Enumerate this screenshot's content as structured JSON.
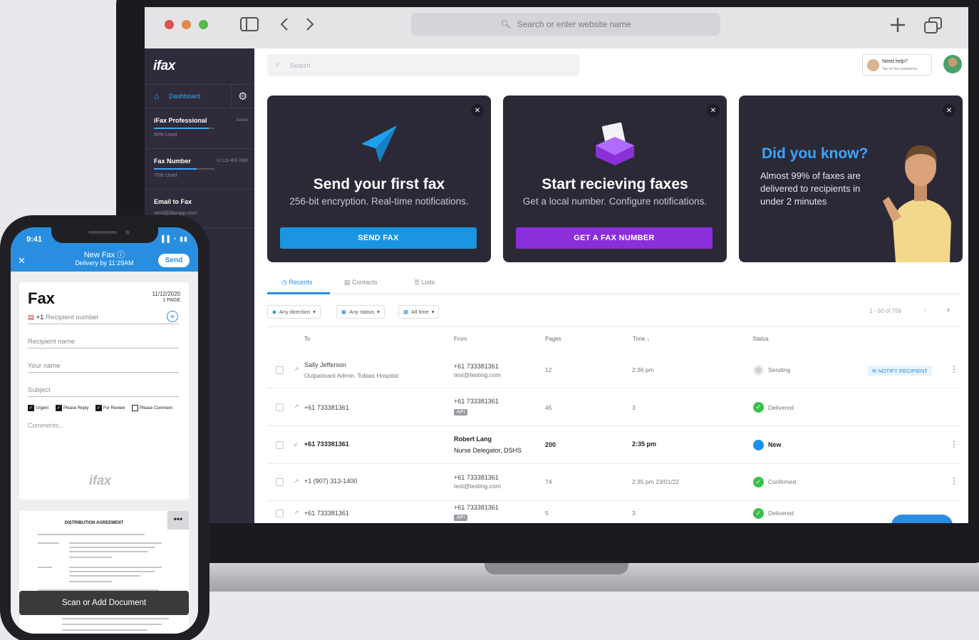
{
  "browser": {
    "address_placeholder": "Search or enter website name"
  },
  "sidebar": {
    "logo": "ifax",
    "nav_dashboard": "Dashboard",
    "plan": {
      "title": "iFax Professional",
      "status": "Active",
      "usage": "90% Used",
      "usage_fraction": 0.9
    },
    "fax_number": {
      "title": "Fax Number",
      "number": "+1 123 456 7890",
      "usage": "70% Used",
      "usage_fraction": 0.7
    },
    "email_to_fax": {
      "title": "Email to Fax",
      "email": "send@ifaxapp.com"
    }
  },
  "header": {
    "search_placeholder": "Search",
    "help_title": "Need help?",
    "help_sub": "Tap for live assistance."
  },
  "cards": [
    {
      "title": "Send your first fax",
      "subtitle": "256-bit encryption. Real-time notifications.",
      "button": "SEND FAX",
      "color": "#1a95e0"
    },
    {
      "title": "Start recieving faxes",
      "subtitle": "Get a local number. Configure notifications.",
      "button": "GET A FAX NUMBER",
      "color": "#8b2fd8"
    },
    {
      "title": "Did you know?",
      "text": "Almost 99% of faxes are delivered to recipients in under 2 minutes"
    }
  ],
  "tabs": {
    "recents": "Recents",
    "contacts": "Contacts",
    "lists": "Lists"
  },
  "filters": {
    "direction": "Any direction",
    "status": "Any status",
    "time": "All time",
    "pagination": "1 - 50 of 756"
  },
  "table": {
    "headers": {
      "to": "To",
      "from": "From",
      "pages": "Pages",
      "time": "Time",
      "status": "Status"
    },
    "rows": [
      {
        "to": "Sally Jefferson",
        "to_sub": "Outpatioant Admin, Tobias Hospital",
        "from": "+61 733381361",
        "from_sub": "test@testing.com",
        "pages": "12",
        "time": "2:36 pm",
        "status": "Sending",
        "action": "NOTIFY RECIPIENT"
      },
      {
        "to": "+61 733381361",
        "from": "+61 733381361",
        "from_tag": "API",
        "pages": "45",
        "time": "3",
        "status": "Delivered"
      },
      {
        "to": "+61 733381361",
        "from": "Robert Lang",
        "from_sub": "Nurse Delegator, DSHS",
        "pages": "200",
        "time": "2:35 pm",
        "status": "New"
      },
      {
        "to": "+1 (907) 313-1400",
        "from": "+61 733381361",
        "from_sub": "test@testing.com",
        "pages": "74",
        "time": "2:35 pm  23/01/22",
        "status": "Confirmed"
      },
      {
        "to": "+61 733381361",
        "from": "+61 733381361",
        "from_tag": "API",
        "pages": "5",
        "time": "3",
        "status": "Delivered"
      }
    ]
  },
  "phone": {
    "time": "9:41",
    "title": "New Fax",
    "subtitle": "Delivery by 11:29AM",
    "send": "Send",
    "fax_heading": "Fax",
    "date": "11/12/2020",
    "pages": "1 PAGE",
    "country_code": "+1",
    "recipient_number": "Recipient number",
    "recipient_name": "Recipient name",
    "your_name": "Your name",
    "subject": "Subject",
    "checks": [
      {
        "label": "Urgent",
        "checked": true
      },
      {
        "label": "Please Reply",
        "checked": true
      },
      {
        "label": "For Review",
        "checked": true
      },
      {
        "label": "Please Comment",
        "checked": false
      }
    ],
    "comments": "Comments...",
    "watermark": "ifax",
    "doc_title": "DISTRIBUTION AGREEMENT",
    "scan_button": "Scan or Add Document"
  }
}
